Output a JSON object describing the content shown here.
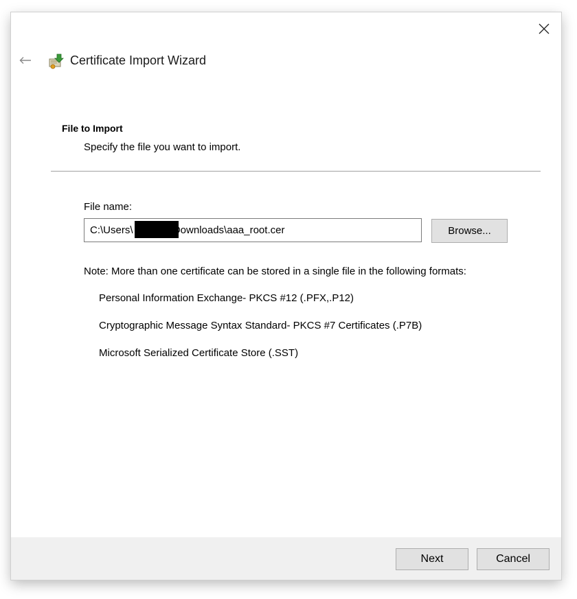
{
  "window": {
    "title": "Certificate Import Wizard"
  },
  "icons": {
    "close": "close-icon",
    "back": "back-arrow-icon",
    "wizard": "certificate-import-icon"
  },
  "page": {
    "heading": "File to Import",
    "subheading": "Specify the file you want to import."
  },
  "file_field": {
    "label": "File name:",
    "value": "C:\\Users\\             \\Downloads\\aaa_root.cer",
    "browse_label": "Browse..."
  },
  "note": {
    "text": "Note:  More than one certificate can be stored in a single file in the following formats:",
    "formats": [
      "Personal Information Exchange- PKCS #12 (.PFX,.P12)",
      "Cryptographic Message Syntax Standard- PKCS #7 Certificates (.P7B)",
      "Microsoft Serialized Certificate Store (.SST)"
    ]
  },
  "footer": {
    "next_label": "Next",
    "cancel_label": "Cancel"
  },
  "colors": {
    "footer_bg": "#f0f0f0",
    "button_bg": "#e1e1e1",
    "button_border": "#adadad",
    "divider": "#a0a0a0"
  }
}
